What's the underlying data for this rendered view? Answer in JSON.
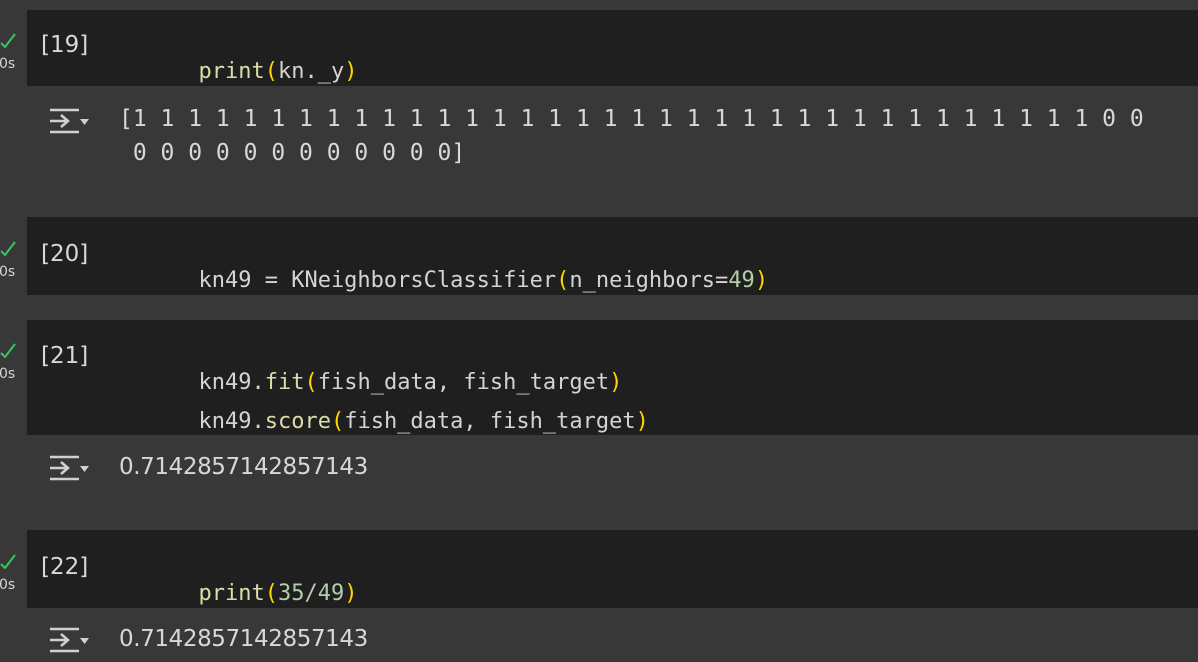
{
  "cells": [
    {
      "exec_count": "[19]",
      "exec_time": "0s",
      "code": [
        {
          "fn": "print",
          "open": "(",
          "arg": "kn._y",
          "close": ")"
        }
      ],
      "output_lines": [
        "[1 1 1 1 1 1 1 1 1 1 1 1 1 1 1 1 1 1 1 1 1 1 1 1 1 1 1 1 1 1 1 1 1 1 1 0 0",
        " 0 0 0 0 0 0 0 0 0 0 0 0]"
      ]
    },
    {
      "exec_count": "[20]",
      "exec_time": "0s",
      "code": [
        {
          "pre": "kn49 = ",
          "fn": "KNeighborsClassifier",
          "open": "(",
          "arg": "n_neighbors=",
          "num": "49",
          "close": ")"
        }
      ]
    },
    {
      "exec_count": "[21]",
      "exec_time": "0s",
      "code": [
        {
          "pre": "kn49.",
          "fn": "fit",
          "open": "(",
          "arg": "fish_data, fish_target",
          "close": ")"
        },
        {
          "pre": "kn49.",
          "fn": "score",
          "open": "(",
          "arg": "fish_data, fish_target",
          "close": ")"
        }
      ],
      "output": "0.7142857142857143"
    },
    {
      "exec_count": "[22]",
      "exec_time": "0s",
      "code": [
        {
          "fn": "print",
          "open": "(",
          "num": "35/49",
          "close": ")"
        }
      ],
      "output": "0.7142857142857143"
    }
  ],
  "icons": {
    "status": "checkmark-icon",
    "output_toggle": "output-expand-icon"
  },
  "colors": {
    "background": "#383838",
    "cell_background": "#1f1f1f",
    "check": "#34c759",
    "function": "#dcdcaa",
    "paren": "#ffd700",
    "number": "#b5cea8"
  }
}
